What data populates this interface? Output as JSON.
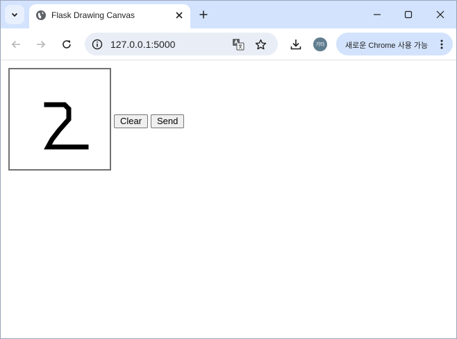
{
  "browser": {
    "tab": {
      "title": "Flask Drawing Canvas"
    },
    "address_bar": {
      "url": "127.0.0.1:5000"
    },
    "profile_label": "기타",
    "chrome_badge": "새로운 Chrome 사용 가능"
  },
  "page": {
    "canvas": {
      "drawn_digit": "2"
    },
    "buttons": {
      "clear": "Clear",
      "send": "Send"
    }
  }
}
